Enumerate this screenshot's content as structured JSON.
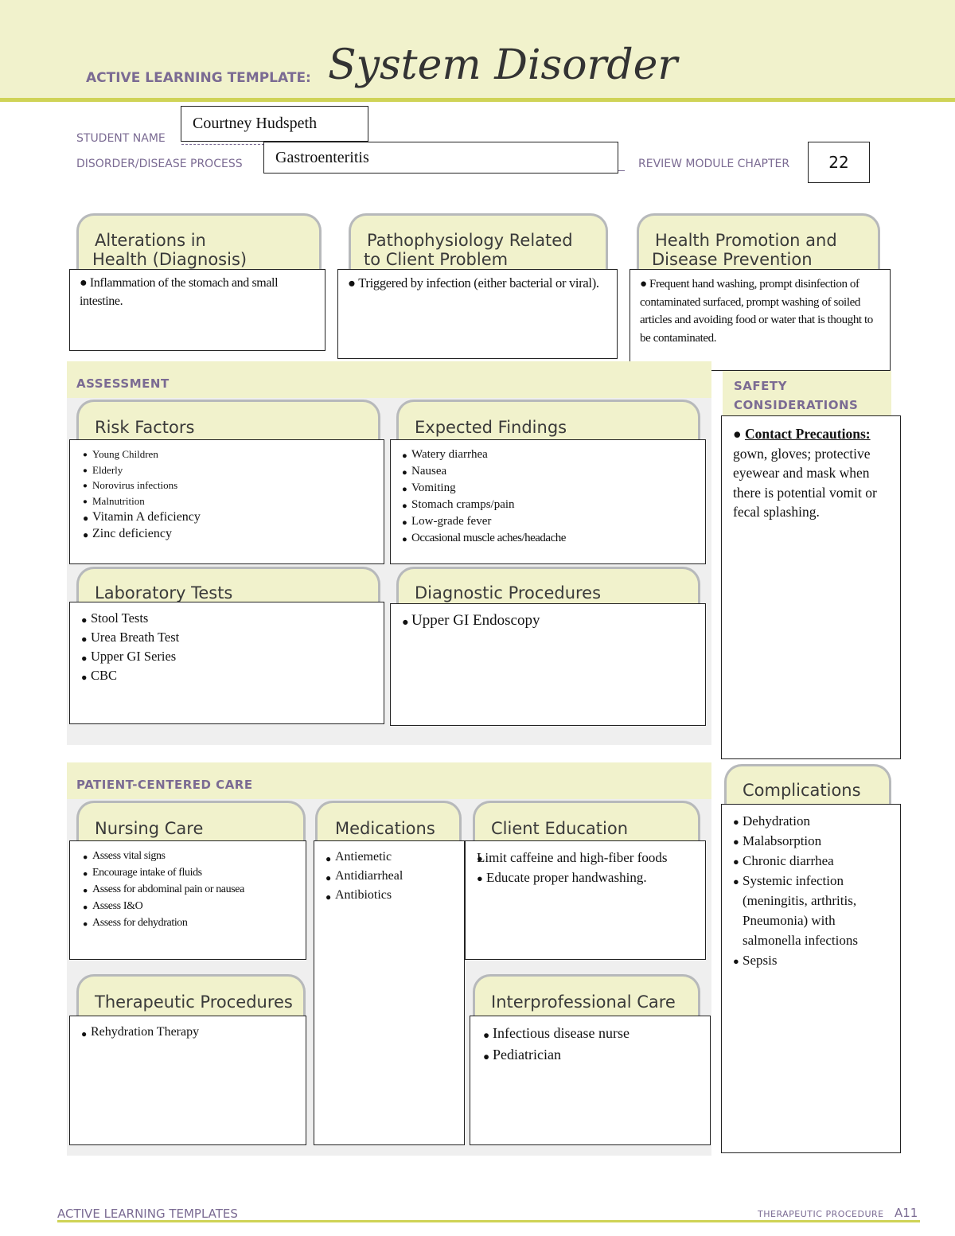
{
  "header": {
    "template_label": "ACTIVE LEARNING TEMPLATE:",
    "template_title": "System Disorder"
  },
  "fields": {
    "student_name_label": "STUDENT NAME",
    "student_name_value": "Courtney Hudspeth",
    "disorder_label": "DISORDER/DISEASE PROCESS",
    "disorder_value": "Gastroenteritis",
    "chapter_label": "REVIEW MODULE CHAPTER",
    "chapter_value": "22"
  },
  "top_panels": {
    "alterations": {
      "title_line1": "Alterations in",
      "title_line2": "Health (Diagnosis)",
      "text": "Inflammation of the stomach and small intestine."
    },
    "pathophysiology": {
      "title_line1": "Pathophysiology Related",
      "title_line2": "to Client Problem",
      "text": "Triggered by infection (either bacterial or viral)."
    },
    "health_promotion": {
      "title_line1": "Health Promotion and",
      "title_line2": "Disease Prevention",
      "text": "Frequent hand washing, prompt disinfection of contaminated surfaced, prompt washing of soiled articles and avoiding food or water that is thought to be contaminated."
    }
  },
  "assessment": {
    "section_title": "ASSESSMENT",
    "risk_factors": {
      "title": "Risk Factors",
      "items": [
        "Young Children",
        "Elderly",
        "Norovirus infections",
        "Malnutrition",
        "Vitamin A deficiency",
        "Zinc deficiency"
      ]
    },
    "expected_findings": {
      "title": "Expected Findings",
      "items": [
        "Watery diarrhea",
        "Nausea",
        "Vomiting",
        "Stomach cramps/pain",
        "Low-grade fever",
        "Occasional muscle aches/headache"
      ]
    },
    "laboratory_tests": {
      "title": "Laboratory Tests",
      "items": [
        "Stool Tests",
        "Urea Breath Test",
        "Upper GI Series",
        "CBC"
      ]
    },
    "diagnostic_procedures": {
      "title": "Diagnostic Procedures",
      "items": [
        "Upper GI Endoscopy"
      ]
    }
  },
  "safety": {
    "section_title_line1": "SAFETY",
    "section_title_line2": "CONSIDERATIONS",
    "heading": "Contact Precautions:",
    "text": "gown, gloves; protective eyewear and mask when there is potential vomit or fecal splashing."
  },
  "patient_care": {
    "section_title": "PATIENT-CENTERED CARE",
    "nursing_care": {
      "title": "Nursing Care",
      "items": [
        "Assess vital signs",
        "Encourage intake of fluids",
        "Assess for abdominal pain or nausea",
        "Assess I&O",
        "Assess for dehydration"
      ]
    },
    "medications": {
      "title": "Medications",
      "items": [
        "Antiemetic",
        "Antidiarrheal",
        "Antibiotics"
      ]
    },
    "client_education": {
      "title": "Client Education",
      "items": [
        "Limit caffeine and high-fiber foods",
        "Educate proper handwashing."
      ]
    },
    "therapeutic_procedures": {
      "title": "Therapeutic Procedures",
      "items": [
        "Rehydration Therapy"
      ]
    },
    "interprofessional_care": {
      "title": "Interprofessional Care",
      "items": [
        "Infectious disease nurse",
        "Pediatrician"
      ]
    }
  },
  "complications": {
    "title": "Complications",
    "items": [
      "Dehydration",
      "Malabsorption",
      "Chronic diarrhea",
      "Systemic infection (meningitis, arthritis, Pneumonia) with salmonella infections",
      "Sepsis"
    ]
  },
  "footer": {
    "left": "ACTIVE LEARNING TEMPLATES",
    "right": "THERAPEUTIC PROCEDURE",
    "page": "A11"
  }
}
